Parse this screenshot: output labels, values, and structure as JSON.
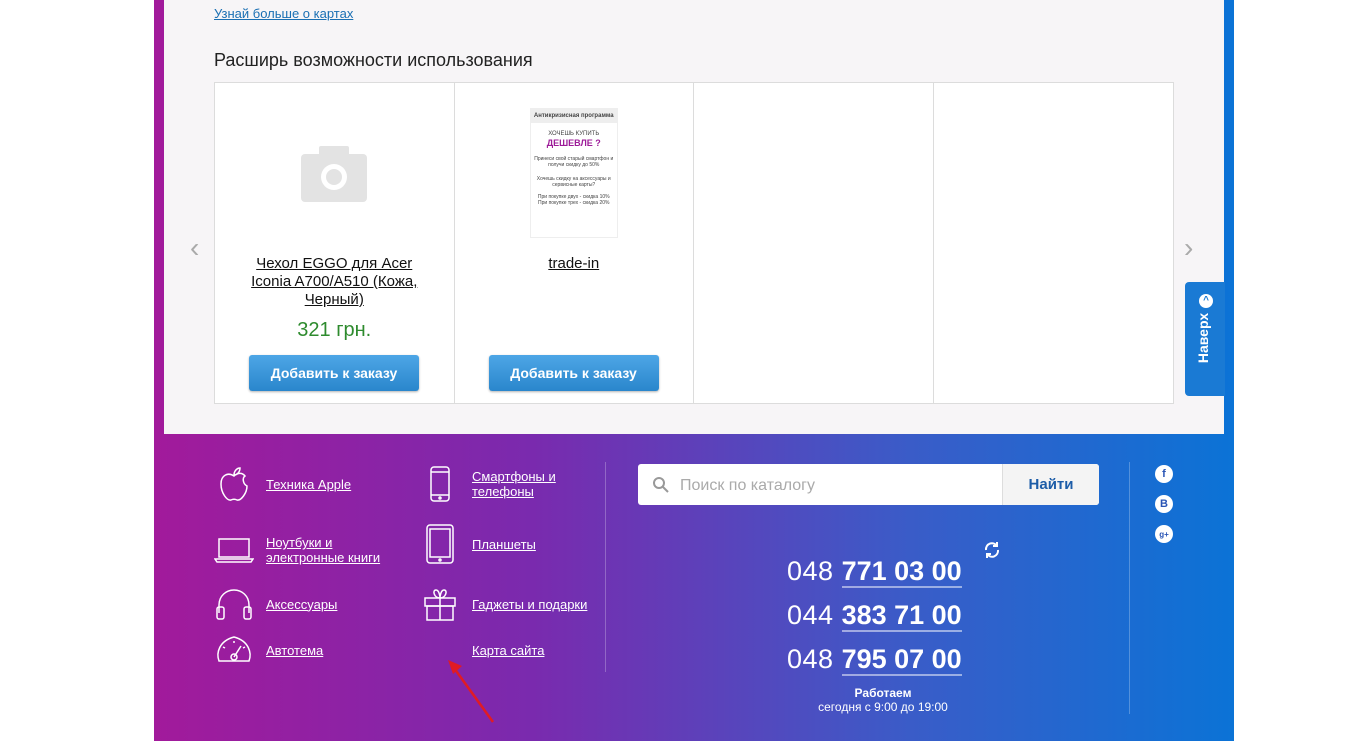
{
  "links": {
    "learn_more_cards": "Узнай больше о картах"
  },
  "section": {
    "title": "Расширь возможности использования"
  },
  "products": [
    {
      "name": "Чехол EGGO для Acer Iconia A700/A510 (Кожа, Черный)",
      "price": "321 грн.",
      "button": "Добавить к заказу",
      "image": "camera-placeholder-icon"
    },
    {
      "name": "trade-in",
      "price": "",
      "button": "Добавить к заказу",
      "image": "trade-in-promo"
    }
  ],
  "promo": {
    "header": "Антикризисная программа",
    "line1": "ХОЧЕШЬ КУПИТЬ",
    "line2": "ДЕШЕВЛЕ ?",
    "line3": "Принеси свой старый смартфон и получи скидку до 50%",
    "line4": "Хочешь скидку на аксессуары и сервисные карты?",
    "line5": "При покупке двух - скидка 10%",
    "line6": "При покупке трех - скидка 20%"
  },
  "carousel": {
    "prev": "‹",
    "next": "›"
  },
  "to_top": {
    "label": "Наверх"
  },
  "footer_nav": [
    {
      "label": "Техника Apple",
      "icon": "apple-icon"
    },
    {
      "label": "Смартфоны и телефоны",
      "icon": "smartphone-icon"
    },
    {
      "label": "Ноутбуки и электронные книги",
      "icon": "laptop-icon"
    },
    {
      "label": "Планшеты",
      "icon": "tablet-icon"
    },
    {
      "label": "Аксессуары",
      "icon": "headphones-icon"
    },
    {
      "label": "Гаджеты и подарки",
      "icon": "gift-icon"
    },
    {
      "label": "Автотема",
      "icon": "speedometer-icon"
    },
    {
      "label": "Карта сайта",
      "icon": ""
    }
  ],
  "search": {
    "placeholder": "Поиск по каталогу",
    "button": "Найти"
  },
  "phones": [
    {
      "code": "048",
      "number": "771 03 00"
    },
    {
      "code": "044",
      "number": "383 71 00"
    },
    {
      "code": "048",
      "number": "795 07 00"
    }
  ],
  "hours": {
    "title": "Работаем",
    "text": "сегодня с 9:00 до 19:00"
  },
  "social": [
    {
      "icon": "facebook-icon",
      "glyph": "f"
    },
    {
      "icon": "vk-icon",
      "glyph": "B"
    },
    {
      "icon": "google-plus-icon",
      "glyph": "g+"
    }
  ],
  "colors": {
    "accent": "#2a86cc",
    "price": "#2e8b2e",
    "gradient_start": "#a21a9b",
    "gradient_end": "#0b73d6"
  }
}
